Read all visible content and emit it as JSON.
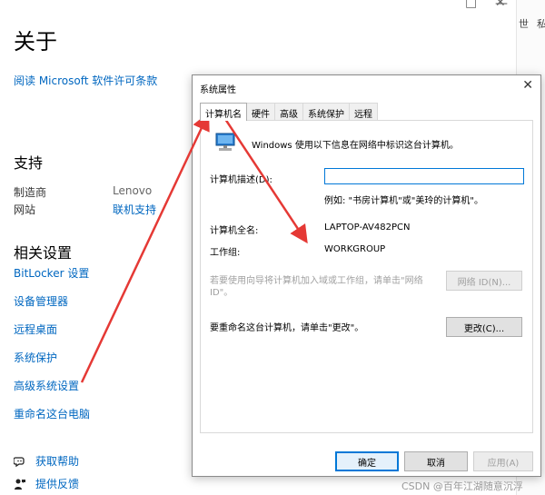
{
  "settings": {
    "page_title": "关于",
    "license_link": "阅读 Microsoft 软件许可条款",
    "support": {
      "title": "支持",
      "manufacturer_label": "制造商",
      "manufacturer_value": "Lenovo",
      "website_label": "网站",
      "website_value": "联机支持"
    },
    "related": {
      "title": "相关设置",
      "items": [
        "BitLocker 设置",
        "设备管理器",
        "远程桌面",
        "系统保护",
        "高级系统设置",
        "重命名这台电脑"
      ]
    },
    "help": [
      {
        "label": "获取帮助",
        "icon": "chat-help-icon"
      },
      {
        "label": "提供反馈",
        "icon": "feedback-person-icon"
      }
    ],
    "right_strip_chars": [
      "世",
      "私"
    ]
  },
  "dialog": {
    "title": "系统属性",
    "tabs": [
      "计算机名",
      "硬件",
      "高级",
      "系统保护",
      "远程"
    ],
    "active_tab": "计算机名",
    "intro": "Windows 使用以下信息在网络中标识这台计算机。",
    "desc_label": "计算机描述(D):",
    "desc_value": "",
    "desc_example": "例如: \"书房计算机\"或\"美玲的计算机\"。",
    "full_name_label": "计算机全名:",
    "full_name_value": "LAPTOP-AV482PCN",
    "workgroup_label": "工作组:",
    "workgroup_value": "WORKGROUP",
    "network_hint_line1": "若要使用向导将计算机加入域或工作组，请单击\"网络",
    "network_hint_line2": "ID\"。",
    "network_id_button": "网络 ID(N)...",
    "rename_hint": "要重命名这台计算机，请单击\"更改\"。",
    "change_button": "更改(C)...",
    "ok_button": "确定",
    "cancel_button": "取消",
    "apply_button": "应用(A)"
  },
  "watermark": "CSDN @百年江湖随意沉浮",
  "colors": {
    "link": "#0067c0",
    "arrow": "#e53935",
    "accent": "#0078d7"
  }
}
